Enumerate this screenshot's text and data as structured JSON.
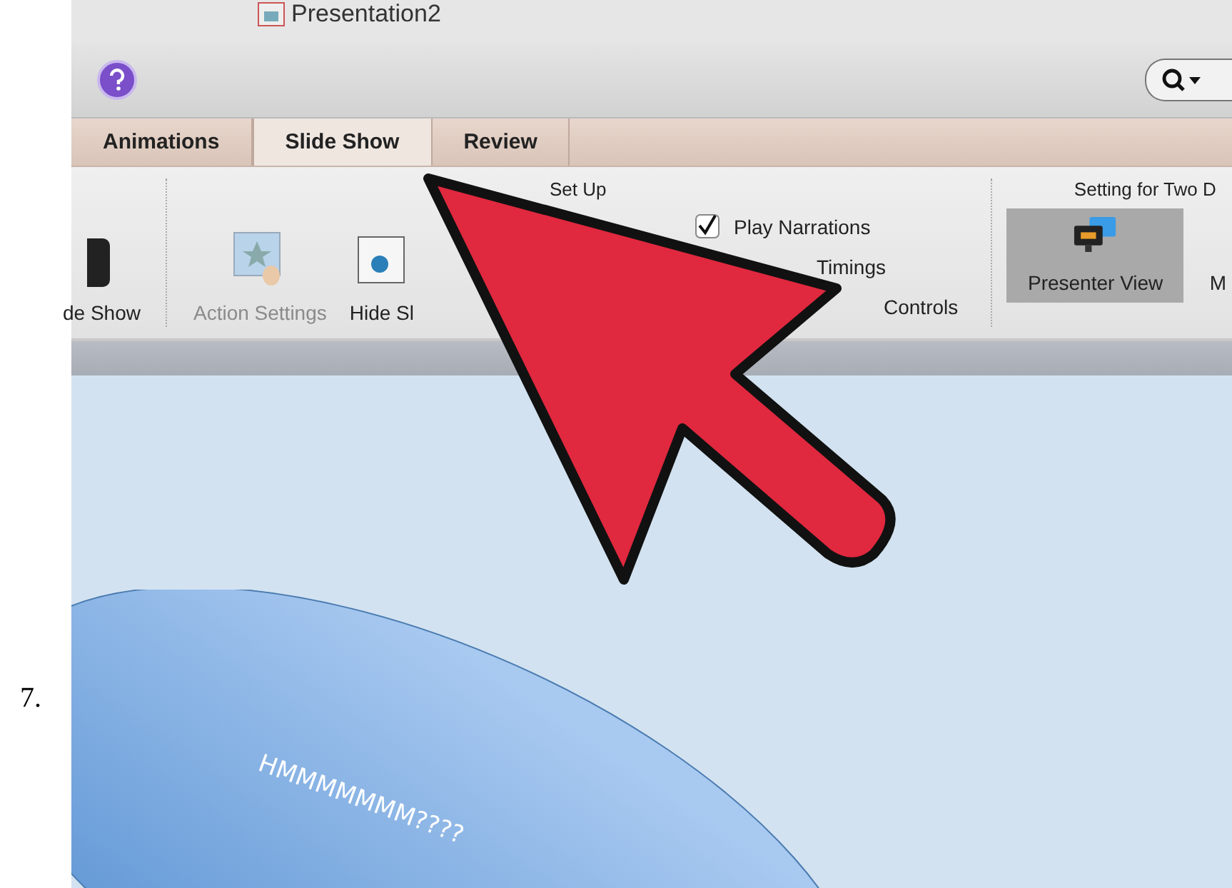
{
  "step_number": "7.",
  "window": {
    "title": "Presentation2"
  },
  "tabs": [
    {
      "label": "Animations",
      "selected": false
    },
    {
      "label": "Slide Show",
      "selected": true
    },
    {
      "label": "Review",
      "selected": false
    }
  ],
  "ribbon": {
    "buttons": [
      {
        "label": "de Show",
        "disabled": false,
        "kind": "slideshow"
      },
      {
        "label": "Action Settings",
        "disabled": true,
        "kind": "action"
      },
      {
        "label": "Hide Sl",
        "disabled": false,
        "kind": "hide"
      }
    ],
    "setup": {
      "title": "Set Up",
      "options": [
        {
          "kind": "checkbox",
          "label": "Play Narrations",
          "checked": true
        },
        {
          "kind": "text",
          "label": "Timings"
        },
        {
          "kind": "text",
          "label": "Controls"
        }
      ]
    },
    "displays": {
      "title": "Setting for Two D",
      "buttons": [
        {
          "label": "Presenter View",
          "selected": true
        },
        {
          "label": "M",
          "selected": false
        }
      ]
    }
  },
  "slide": {
    "shape_text": "HMMMMMMM????"
  }
}
